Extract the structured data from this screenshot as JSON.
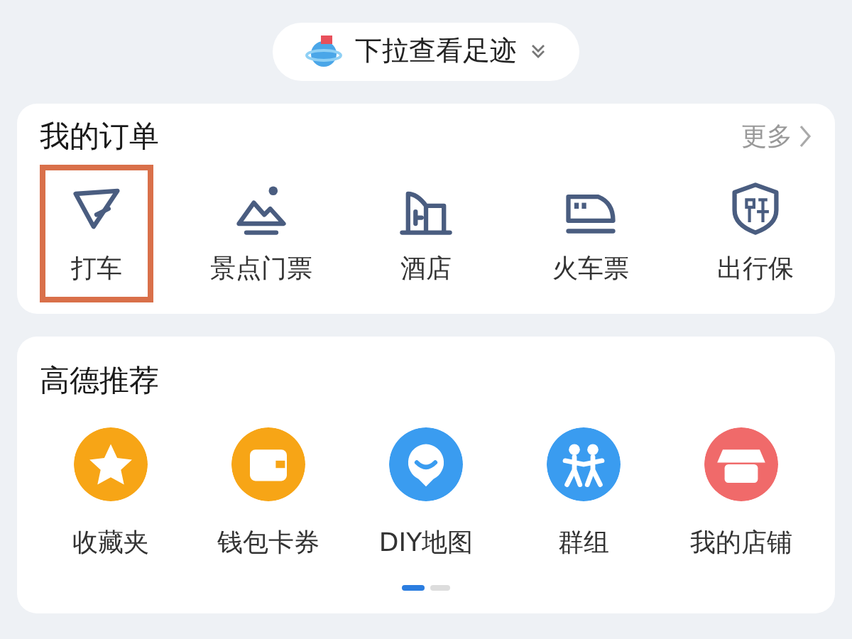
{
  "pull_hint": {
    "label": "下拉查看足迹"
  },
  "orders": {
    "title": "我的订单",
    "more": "更多",
    "items": [
      {
        "kind": "taxi",
        "label": "打车",
        "highlighted": true
      },
      {
        "kind": "scenic",
        "label": "景点门票",
        "highlighted": false
      },
      {
        "kind": "hotel",
        "label": "酒店",
        "highlighted": false
      },
      {
        "kind": "train",
        "label": "火车票",
        "highlighted": false
      },
      {
        "kind": "insurance",
        "label": "出行保",
        "highlighted": false
      }
    ]
  },
  "recommend": {
    "title": "高德推荐",
    "items": [
      {
        "kind": "favorites",
        "label": "收藏夹",
        "color": "#f7a516"
      },
      {
        "kind": "wallet",
        "label": "钱包卡券",
        "color": "#f7a516"
      },
      {
        "kind": "diymap",
        "label": "DIY地图",
        "color": "#3a9cf0"
      },
      {
        "kind": "group",
        "label": "群组",
        "color": "#3a9cf0"
      },
      {
        "kind": "shop",
        "label": "我的店铺",
        "color": "#f06a6a"
      }
    ],
    "pages": [
      {
        "selected": true
      },
      {
        "selected": false
      }
    ]
  }
}
